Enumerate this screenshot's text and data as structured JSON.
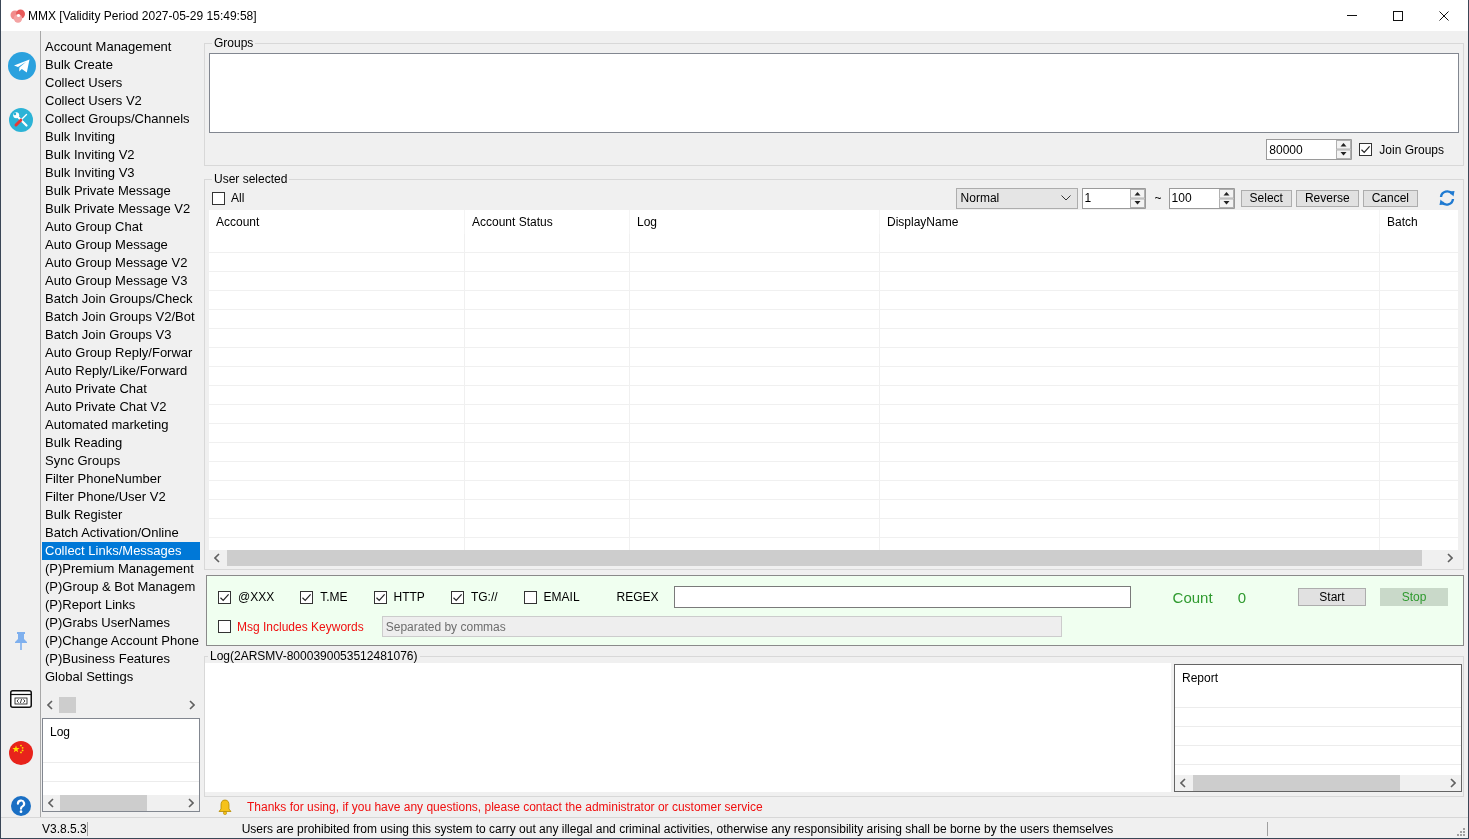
{
  "window": {
    "title": "MMX [Validity Period 2027-05-29 15:49:58]"
  },
  "sidebar": {
    "items": [
      {
        "label": "Account Management",
        "selected": false
      },
      {
        "label": "Bulk Create",
        "selected": false
      },
      {
        "label": "Collect Users",
        "selected": false
      },
      {
        "label": "Collect Users V2",
        "selected": false
      },
      {
        "label": "Collect Groups/Channels",
        "selected": false
      },
      {
        "label": "Bulk Inviting",
        "selected": false
      },
      {
        "label": "Bulk Inviting V2",
        "selected": false
      },
      {
        "label": "Bulk Inviting V3",
        "selected": false
      },
      {
        "label": "Bulk Private Message",
        "selected": false
      },
      {
        "label": "Bulk Private Message V2",
        "selected": false
      },
      {
        "label": "Auto Group Chat",
        "selected": false
      },
      {
        "label": "Auto Group Message",
        "selected": false
      },
      {
        "label": "Auto Group Message V2",
        "selected": false
      },
      {
        "label": "Auto Group Message V3",
        "selected": false
      },
      {
        "label": "Batch Join Groups/Check",
        "selected": false
      },
      {
        "label": "Batch Join Groups V2/Bot",
        "selected": false
      },
      {
        "label": "Batch Join Groups V3",
        "selected": false
      },
      {
        "label": "Auto Group Reply/Forwar",
        "selected": false
      },
      {
        "label": "Auto Reply/Like/Forward",
        "selected": false
      },
      {
        "label": "Auto Private Chat",
        "selected": false
      },
      {
        "label": "Auto Private Chat V2",
        "selected": false
      },
      {
        "label": "Automated marketing",
        "selected": false
      },
      {
        "label": "Bulk Reading",
        "selected": false
      },
      {
        "label": "Sync Groups",
        "selected": false
      },
      {
        "label": "Filter PhoneNumber",
        "selected": false
      },
      {
        "label": "Filter Phone/User V2",
        "selected": false
      },
      {
        "label": "Bulk Register",
        "selected": false
      },
      {
        "label": "Batch Activation/Online",
        "selected": false
      },
      {
        "label": "Collect Links/Messages",
        "selected": true
      },
      {
        "label": "(P)Premium Management",
        "selected": false
      },
      {
        "label": "(P)Group & Bot Managem",
        "selected": false
      },
      {
        "label": "(P)Report Links",
        "selected": false
      },
      {
        "label": "(P)Grabs UserNames",
        "selected": false
      },
      {
        "label": "(P)Change Account Phone",
        "selected": false
      },
      {
        "label": "(P)Business Features",
        "selected": false
      },
      {
        "label": "Global Settings",
        "selected": false
      }
    ],
    "log_header": "Log"
  },
  "groups": {
    "title": "Groups",
    "limit": "80000",
    "join_groups": {
      "label": "Join Groups",
      "checked": true
    }
  },
  "user_selected": {
    "title": "User selected",
    "all": {
      "label": "All",
      "checked": false
    },
    "mode": "Normal",
    "range_from": "1",
    "range_separator": "~",
    "range_to": "100",
    "buttons": [
      "Select",
      "Reverse",
      "Cancel"
    ],
    "table": {
      "columns": [
        "Account",
        "Account Status",
        "Log",
        "DisplayName",
        "Batch"
      ]
    }
  },
  "collect": {
    "options": [
      {
        "label": "@XXX",
        "checked": true
      },
      {
        "label": "T.ME",
        "checked": true
      },
      {
        "label": "HTTP",
        "checked": true
      },
      {
        "label": "TG://",
        "checked": true
      },
      {
        "label": "EMAIL",
        "checked": false
      }
    ],
    "regex_label": "REGEX",
    "count_label": "Count",
    "count": "0",
    "buttons": [
      {
        "label": "Start",
        "disabled": false
      },
      {
        "label": "Stop",
        "disabled": true
      }
    ],
    "keywords": {
      "label": "Msg Includes Keywords",
      "checked": false
    },
    "keywords_field": {
      "placeholder": "Separated by commas",
      "disabled": true
    }
  },
  "log": {
    "title": "Log(2ARSMV-8000390053512481076)",
    "report_header": "Report"
  },
  "notice": "Thanks for using, if you have any questions, please contact the administrator or customer service",
  "status_bar": {
    "version": "V3.8.5.3",
    "message": "Users are prohibited from using this system to carry out any illegal and criminal activities, otherwise any responsibility arising shall be borne by the users themselves"
  }
}
